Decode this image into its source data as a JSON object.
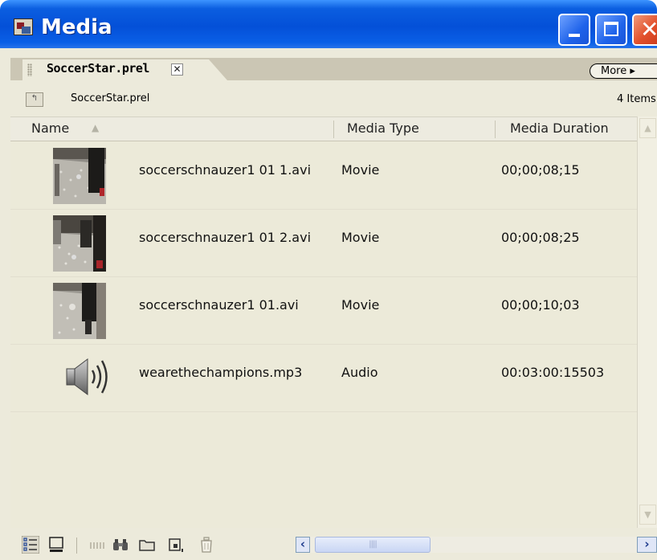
{
  "window": {
    "title": "Media"
  },
  "tab": {
    "label": "SoccerStar.prel",
    "close_glyph": "✕"
  },
  "more_button": {
    "label": "More ▸"
  },
  "path": {
    "label": "SoccerStar.prel",
    "items_count": "4 Items"
  },
  "columns": {
    "name": "Name",
    "media_type": "Media Type",
    "media_duration": "Media Duration"
  },
  "rows": [
    {
      "name": "soccerschnauzer1 01 1.avi",
      "type": "Movie",
      "duration": "00;00;08;15",
      "thumbnail": "video-thumbnail"
    },
    {
      "name": "soccerschnauzer1 01 2.avi",
      "type": "Movie",
      "duration": "00;00;08;25",
      "thumbnail": "video-thumbnail"
    },
    {
      "name": "soccerschnauzer1 01.avi",
      "type": "Movie",
      "duration": "00;00;10;03",
      "thumbnail": "video-thumbnail"
    },
    {
      "name": "wearethechampions.mp3",
      "type": "Audio",
      "duration": "00:03:00:15503",
      "thumbnail": "speaker-icon"
    }
  ],
  "toolbar": {
    "icons": [
      "list-view-icon",
      "icon-view-icon",
      "storyboard-icon",
      "find-icon",
      "new-bin-icon",
      "new-item-icon",
      "delete-icon"
    ]
  },
  "colors": {
    "title_bar": "#0450d8",
    "panel": "#eceadb",
    "close_button": "#e2502b"
  }
}
